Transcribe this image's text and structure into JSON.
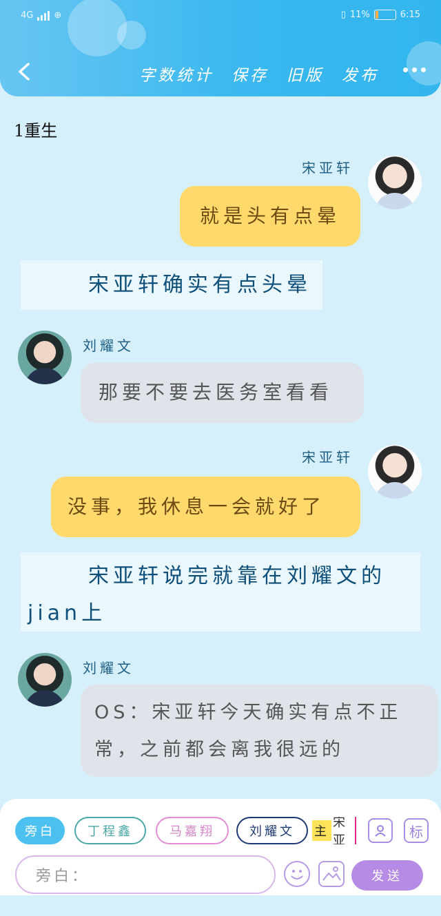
{
  "status_bar": {
    "network": "4G",
    "battery": "11%",
    "time": "6:15"
  },
  "header": {
    "back_icon": "chevron-left-icon",
    "nav": [
      "字数统计",
      "保存",
      "旧版",
      "发布"
    ],
    "more_icon": "more-dots-icon"
  },
  "chapter_title": "1重生",
  "messages": [
    {
      "type": "right",
      "speaker": "宋亚轩",
      "text": "就是头有点晕"
    },
    {
      "type": "narration",
      "text": "宋亚轩确实有点头晕"
    },
    {
      "type": "left",
      "speaker": "刘耀文",
      "text": "那要不要去医务室看看"
    },
    {
      "type": "right",
      "speaker": "宋亚轩",
      "text": "没事，我休息一会就好了"
    },
    {
      "type": "narration",
      "line1": "宋亚轩说完就靠在刘耀文的",
      "line2": "jian上"
    },
    {
      "type": "left",
      "speaker": "刘耀文",
      "line1": "OS：宋亚轩今天确实有点不正",
      "line2": "常，之前都会离我很远的"
    }
  ],
  "composer": {
    "chips": [
      "旁白",
      "丁程鑫",
      "马嘉翔",
      "刘耀文"
    ],
    "partial_chip": {
      "highlight": "主",
      "rest": "宋亚"
    },
    "mark_label": "标",
    "input_placeholder": "旁白：",
    "send_label": "发送",
    "icons": [
      "person-card-icon",
      "emoji-icon",
      "image-icon"
    ]
  },
  "colors": {
    "header": "#3ab8ef",
    "accent": "#b68be6",
    "bubble_right": "#ffd96b",
    "bubble_left": "#dfe4ea",
    "background": "#d6f0fb"
  }
}
